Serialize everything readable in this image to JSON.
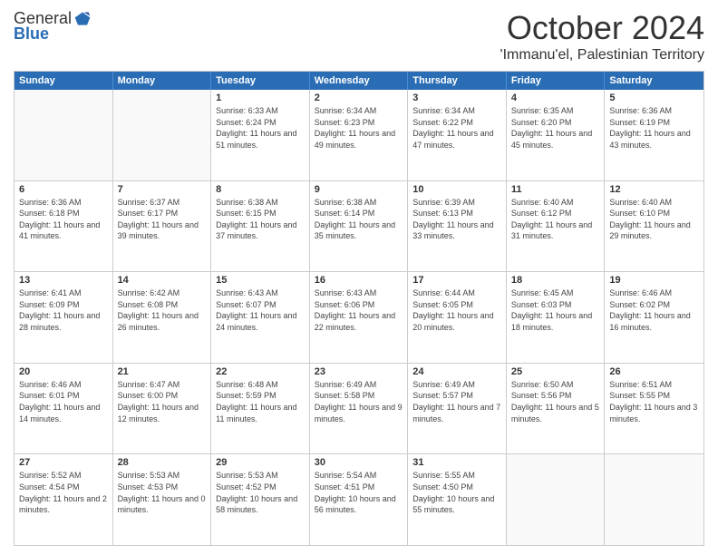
{
  "header": {
    "logo_general": "General",
    "logo_blue": "Blue",
    "month": "October 2024",
    "location": "'Immanu'el, Palestinian Territory"
  },
  "weekdays": [
    "Sunday",
    "Monday",
    "Tuesday",
    "Wednesday",
    "Thursday",
    "Friday",
    "Saturday"
  ],
  "rows": [
    [
      {
        "day": "",
        "sunrise": "",
        "sunset": "",
        "daylight": ""
      },
      {
        "day": "",
        "sunrise": "",
        "sunset": "",
        "daylight": ""
      },
      {
        "day": "1",
        "sunrise": "Sunrise: 6:33 AM",
        "sunset": "Sunset: 6:24 PM",
        "daylight": "Daylight: 11 hours and 51 minutes."
      },
      {
        "day": "2",
        "sunrise": "Sunrise: 6:34 AM",
        "sunset": "Sunset: 6:23 PM",
        "daylight": "Daylight: 11 hours and 49 minutes."
      },
      {
        "day": "3",
        "sunrise": "Sunrise: 6:34 AM",
        "sunset": "Sunset: 6:22 PM",
        "daylight": "Daylight: 11 hours and 47 minutes."
      },
      {
        "day": "4",
        "sunrise": "Sunrise: 6:35 AM",
        "sunset": "Sunset: 6:20 PM",
        "daylight": "Daylight: 11 hours and 45 minutes."
      },
      {
        "day": "5",
        "sunrise": "Sunrise: 6:36 AM",
        "sunset": "Sunset: 6:19 PM",
        "daylight": "Daylight: 11 hours and 43 minutes."
      }
    ],
    [
      {
        "day": "6",
        "sunrise": "Sunrise: 6:36 AM",
        "sunset": "Sunset: 6:18 PM",
        "daylight": "Daylight: 11 hours and 41 minutes."
      },
      {
        "day": "7",
        "sunrise": "Sunrise: 6:37 AM",
        "sunset": "Sunset: 6:17 PM",
        "daylight": "Daylight: 11 hours and 39 minutes."
      },
      {
        "day": "8",
        "sunrise": "Sunrise: 6:38 AM",
        "sunset": "Sunset: 6:15 PM",
        "daylight": "Daylight: 11 hours and 37 minutes."
      },
      {
        "day": "9",
        "sunrise": "Sunrise: 6:38 AM",
        "sunset": "Sunset: 6:14 PM",
        "daylight": "Daylight: 11 hours and 35 minutes."
      },
      {
        "day": "10",
        "sunrise": "Sunrise: 6:39 AM",
        "sunset": "Sunset: 6:13 PM",
        "daylight": "Daylight: 11 hours and 33 minutes."
      },
      {
        "day": "11",
        "sunrise": "Sunrise: 6:40 AM",
        "sunset": "Sunset: 6:12 PM",
        "daylight": "Daylight: 11 hours and 31 minutes."
      },
      {
        "day": "12",
        "sunrise": "Sunrise: 6:40 AM",
        "sunset": "Sunset: 6:10 PM",
        "daylight": "Daylight: 11 hours and 29 minutes."
      }
    ],
    [
      {
        "day": "13",
        "sunrise": "Sunrise: 6:41 AM",
        "sunset": "Sunset: 6:09 PM",
        "daylight": "Daylight: 11 hours and 28 minutes."
      },
      {
        "day": "14",
        "sunrise": "Sunrise: 6:42 AM",
        "sunset": "Sunset: 6:08 PM",
        "daylight": "Daylight: 11 hours and 26 minutes."
      },
      {
        "day": "15",
        "sunrise": "Sunrise: 6:43 AM",
        "sunset": "Sunset: 6:07 PM",
        "daylight": "Daylight: 11 hours and 24 minutes."
      },
      {
        "day": "16",
        "sunrise": "Sunrise: 6:43 AM",
        "sunset": "Sunset: 6:06 PM",
        "daylight": "Daylight: 11 hours and 22 minutes."
      },
      {
        "day": "17",
        "sunrise": "Sunrise: 6:44 AM",
        "sunset": "Sunset: 6:05 PM",
        "daylight": "Daylight: 11 hours and 20 minutes."
      },
      {
        "day": "18",
        "sunrise": "Sunrise: 6:45 AM",
        "sunset": "Sunset: 6:03 PM",
        "daylight": "Daylight: 11 hours and 18 minutes."
      },
      {
        "day": "19",
        "sunrise": "Sunrise: 6:46 AM",
        "sunset": "Sunset: 6:02 PM",
        "daylight": "Daylight: 11 hours and 16 minutes."
      }
    ],
    [
      {
        "day": "20",
        "sunrise": "Sunrise: 6:46 AM",
        "sunset": "Sunset: 6:01 PM",
        "daylight": "Daylight: 11 hours and 14 minutes."
      },
      {
        "day": "21",
        "sunrise": "Sunrise: 6:47 AM",
        "sunset": "Sunset: 6:00 PM",
        "daylight": "Daylight: 11 hours and 12 minutes."
      },
      {
        "day": "22",
        "sunrise": "Sunrise: 6:48 AM",
        "sunset": "Sunset: 5:59 PM",
        "daylight": "Daylight: 11 hours and 11 minutes."
      },
      {
        "day": "23",
        "sunrise": "Sunrise: 6:49 AM",
        "sunset": "Sunset: 5:58 PM",
        "daylight": "Daylight: 11 hours and 9 minutes."
      },
      {
        "day": "24",
        "sunrise": "Sunrise: 6:49 AM",
        "sunset": "Sunset: 5:57 PM",
        "daylight": "Daylight: 11 hours and 7 minutes."
      },
      {
        "day": "25",
        "sunrise": "Sunrise: 6:50 AM",
        "sunset": "Sunset: 5:56 PM",
        "daylight": "Daylight: 11 hours and 5 minutes."
      },
      {
        "day": "26",
        "sunrise": "Sunrise: 6:51 AM",
        "sunset": "Sunset: 5:55 PM",
        "daylight": "Daylight: 11 hours and 3 minutes."
      }
    ],
    [
      {
        "day": "27",
        "sunrise": "Sunrise: 5:52 AM",
        "sunset": "Sunset: 4:54 PM",
        "daylight": "Daylight: 11 hours and 2 minutes."
      },
      {
        "day": "28",
        "sunrise": "Sunrise: 5:53 AM",
        "sunset": "Sunset: 4:53 PM",
        "daylight": "Daylight: 11 hours and 0 minutes."
      },
      {
        "day": "29",
        "sunrise": "Sunrise: 5:53 AM",
        "sunset": "Sunset: 4:52 PM",
        "daylight": "Daylight: 10 hours and 58 minutes."
      },
      {
        "day": "30",
        "sunrise": "Sunrise: 5:54 AM",
        "sunset": "Sunset: 4:51 PM",
        "daylight": "Daylight: 10 hours and 56 minutes."
      },
      {
        "day": "31",
        "sunrise": "Sunrise: 5:55 AM",
        "sunset": "Sunset: 4:50 PM",
        "daylight": "Daylight: 10 hours and 55 minutes."
      },
      {
        "day": "",
        "sunrise": "",
        "sunset": "",
        "daylight": ""
      },
      {
        "day": "",
        "sunrise": "",
        "sunset": "",
        "daylight": ""
      }
    ]
  ]
}
